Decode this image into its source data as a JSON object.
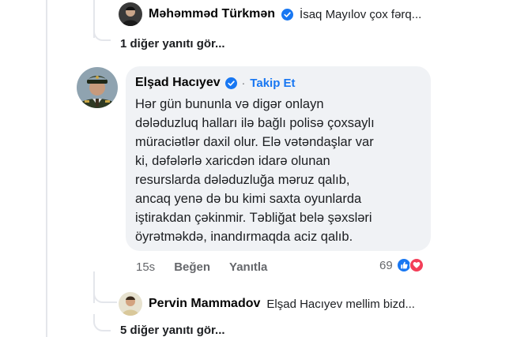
{
  "top_reply": {
    "author": "Məhəmməd Türkmən",
    "text": "İsaq Mayılov çox fərq..."
  },
  "more_replies_top": "1 diğer yanıtı gör...",
  "comment": {
    "author": "Elşad Hacıyev",
    "separator": "·",
    "follow_label": "Takip Et",
    "lines": [
      "Hər gün bununla və digər onlayn",
      "dələduzluq halları ilə bağlı polisə çoxsaylı",
      "müraciətlər daxil olur. Elə vətəndaşlar var",
      "ki, dəfələrlə xaricdən idarə olunan",
      "resurslarda dələduzluğa məruz qalıb,",
      "ancaq yenə də bu kimi saxta oyunlarda",
      "iştirakdan çəkinmir. Təbliğat belə şəxsləri",
      "öyrətməkdə, inandırmaqda aciz qalıb."
    ],
    "time": "15s",
    "like_label": "Beğen",
    "reply_label": "Yanıtla",
    "reaction_count": "69"
  },
  "bottom_reply": {
    "author": "Pervin Mammadov",
    "text": "Elşad Hacıyev mellim bizd..."
  },
  "more_replies_bottom": "5 diğer yanıtı gör...",
  "colors": {
    "bubble": "#f0f2f5",
    "link_blue": "#1877f2",
    "muted": "#65676b",
    "love": "#f33e58"
  },
  "icons": [
    "verified-badge-icon",
    "like-reaction-icon",
    "love-reaction-icon"
  ]
}
